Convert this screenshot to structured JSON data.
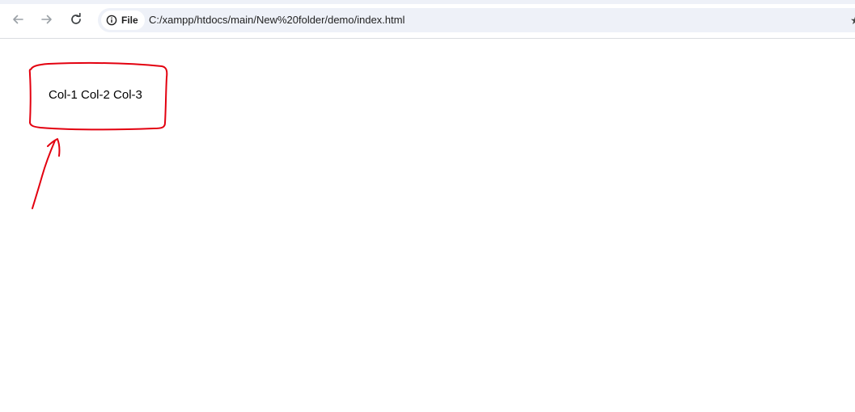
{
  "browser": {
    "security_chip_label": "File",
    "url": "C:/xampp/htdocs/main/New%20folder/demo/index.html",
    "star_glyph": "★"
  },
  "icons": {
    "back": "arrow-left-icon",
    "forward": "arrow-right-icon",
    "reload": "reload-icon",
    "info": "info-icon",
    "bookmark": "star-icon"
  },
  "page": {
    "content_text": "Col-1 Col-2 Col-3"
  },
  "colors": {
    "annotation": "#e3000f",
    "omnibox_bg": "#eef1f8",
    "nav_icon": "#5f6368"
  }
}
